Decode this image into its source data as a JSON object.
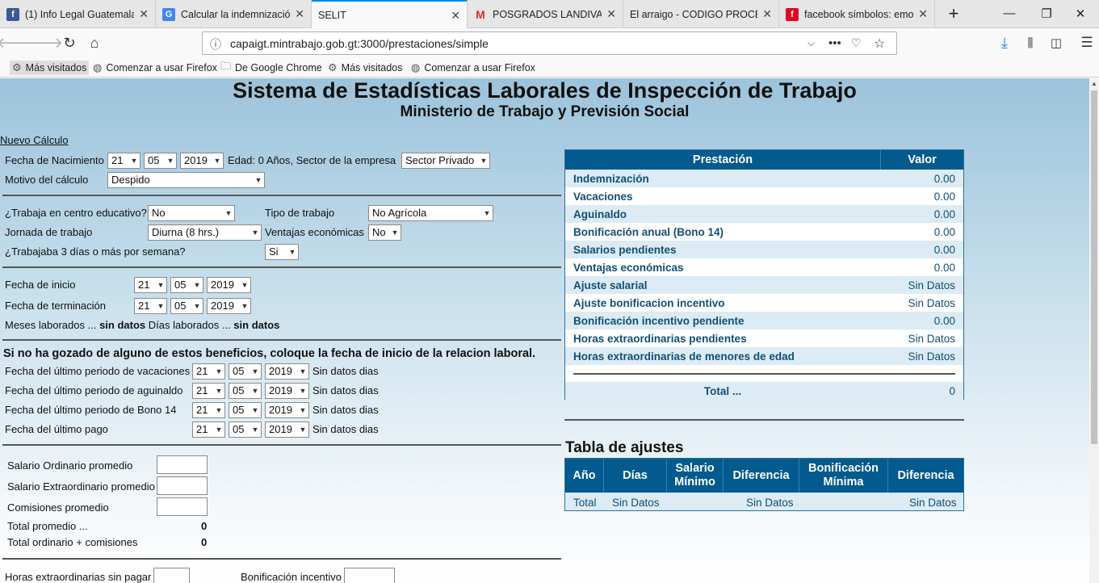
{
  "browser": {
    "tabs": [
      {
        "label": "(1) Info Legal Guatemala",
        "icon": "facebook-icon",
        "color": "#3b5998"
      },
      {
        "label": "Calcular la indemnización",
        "icon": "google-icon",
        "color": "#4285f4"
      },
      {
        "label": "SELIT",
        "icon": "",
        "color": ""
      },
      {
        "label": "POSGRADOS LANDIVAR",
        "icon": "gmail-icon",
        "color": "#d93025"
      },
      {
        "label": "El arraigo - CODIGO PROCESAL",
        "icon": "",
        "color": ""
      },
      {
        "label": "facebook símbolos: emoticones",
        "icon": "pinterest-icon",
        "color": "#e60023"
      }
    ],
    "url": "capaigt.mintrabajo.gob.gt:3000/prestaciones/simple",
    "bookmarks": [
      {
        "label": "Más visitados",
        "icon": "gear-icon"
      },
      {
        "label": "Comenzar a usar Firefox",
        "icon": "globe-icon"
      },
      {
        "label": "De Google Chrome",
        "icon": "folder-icon"
      },
      {
        "label": "Más visitados",
        "icon": "gear-icon"
      },
      {
        "label": "Comenzar a usar Firefox",
        "icon": "globe-icon"
      }
    ]
  },
  "header": {
    "title": "Sistema de Estadísticas Laborales de Inspección de Trabajo",
    "subtitle": "Ministerio de Trabajo y Previsión Social"
  },
  "form": {
    "nuevo_calculo": "Nuevo Cálculo",
    "fecha_nacimiento_label": "Fecha de Nacimiento",
    "fecha_nacimiento": {
      "day": "21",
      "month": "05",
      "year": "2019"
    },
    "edad_text": "Edad: 0 Años, Sector de la empresa",
    "sector": "Sector Privado",
    "motivo_label": "Motivo del cálculo",
    "motivo": "Despido",
    "centro_educativo_label": "¿Trabaja en centro educativo?",
    "centro_educativo": "No",
    "tipo_trabajo_label": "Tipo de trabajo",
    "tipo_trabajo": "No Agrícola",
    "jornada_label": "Jornada de trabajo",
    "jornada": "Diurna (8 hrs.)",
    "ventajas_label": "Ventajas económicas",
    "ventajas": "No",
    "tres_dias_label": "¿Trabajaba 3 días o más por semana?",
    "tres_dias": "Si",
    "fecha_inicio_label": "Fecha de inicio",
    "fecha_inicio": {
      "day": "21",
      "month": "05",
      "year": "2019"
    },
    "fecha_termino_label": "Fecha de terminación",
    "fecha_termino": {
      "day": "21",
      "month": "05",
      "year": "2019"
    },
    "meses_label": "Meses laborados ...",
    "meses_value": "sin datos",
    "dias_label": "Días laborados ...",
    "dias_value": "sin datos",
    "beneficios_heading": "Si no ha gozado de alguno de estos beneficios, coloque la fecha de inicio de la relacion laboral.",
    "periodos": [
      {
        "label": "Fecha del último periodo de vacaciones",
        "day": "21",
        "month": "05",
        "year": "2019",
        "status": "Sin datos dias"
      },
      {
        "label": "Fecha del último periodo de aguinaldo",
        "day": "21",
        "month": "05",
        "year": "2019",
        "status": "Sin datos dias"
      },
      {
        "label": "Fecha del último periodo de Bono 14",
        "day": "21",
        "month": "05",
        "year": "2019",
        "status": "Sin datos dias"
      },
      {
        "label": "Fecha del último pago",
        "day": "21",
        "month": "05",
        "year": "2019",
        "status": "Sin datos dias"
      }
    ],
    "salario_ordinario_label": "Salario Ordinario promedio",
    "salario_extra_label": "Salario Extraordinario promedio",
    "comisiones_label": "Comisiones promedio",
    "total_promedio_label": "Total promedio ...",
    "total_promedio": "0",
    "total_ordinario_label": "Total ordinario + comisiones",
    "total_ordinario": "0",
    "horas_extra_label": "Horas extraordinarias sin pagar",
    "bonificacion_label": "Bonificación incentivo"
  },
  "prestaciones": {
    "col_prestacion": "Prestación",
    "col_valor": "Valor",
    "rows": [
      {
        "name": "Indemnización",
        "value": "0.00"
      },
      {
        "name": "Vacaciones",
        "value": "0.00"
      },
      {
        "name": "Aguinaldo",
        "value": "0.00"
      },
      {
        "name": "Bonificación anual (Bono 14)",
        "value": "0.00"
      },
      {
        "name": "Salarios pendientes",
        "value": "0.00"
      },
      {
        "name": "Ventajas económicas",
        "value": "0.00"
      },
      {
        "name": "Ajuste salarial",
        "value": "Sin Datos"
      },
      {
        "name": "Ajuste bonificacion incentivo",
        "value": "Sin Datos"
      },
      {
        "name": "Bonificación incentivo pendiente",
        "value": "0.00"
      },
      {
        "name": "Horas extraordinarias pendientes",
        "value": "Sin Datos"
      },
      {
        "name": "Horas extraordinarias de menores de edad",
        "value": "Sin Datos"
      }
    ],
    "total_label": "Total ...",
    "total_value": "0"
  },
  "ajustes": {
    "title": "Tabla de ajustes",
    "headers": [
      "Año",
      "Días",
      "Salario Mínimo",
      "Diferencia",
      "Bonificación Mínima",
      "Diferencia"
    ],
    "total_row": [
      "Total",
      "Sin Datos",
      "",
      "Sin Datos",
      "",
      "Sin Datos"
    ]
  }
}
